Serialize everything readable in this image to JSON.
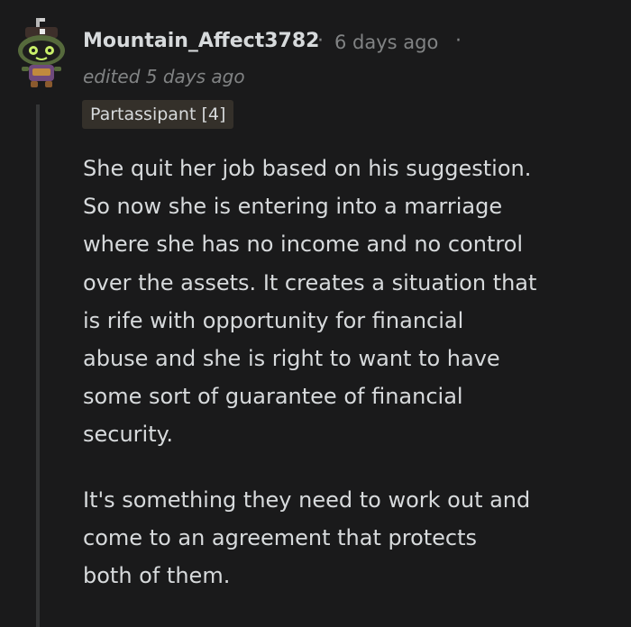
{
  "comment": {
    "avatar_icon": "robot-avatar-icon",
    "username": "Mountain_Affect3782",
    "separator": "·",
    "timestamp": "6 days ago",
    "edited": "edited 5 days ago",
    "flair": "Partassipant [4]",
    "paragraphs": [
      {
        "lines": [
          "She quit her job based on his suggestion.",
          "So now she is entering into a marriage",
          "where she has no income and no control",
          "over the assets. It creates a situation that",
          "is rife with opportunity for financial",
          "abuse and she is right to want to have",
          "some sort of guarantee of financial",
          "security."
        ]
      },
      {
        "lines": [
          "It's something they need to work out and",
          "come to an agreement that protects",
          "both of them."
        ]
      }
    ]
  },
  "colors": {
    "background": "#1a1a1b",
    "text": "#d7dadc",
    "meta": "#818384",
    "flair_bg": "#34302a",
    "thread_line": "#343536"
  }
}
